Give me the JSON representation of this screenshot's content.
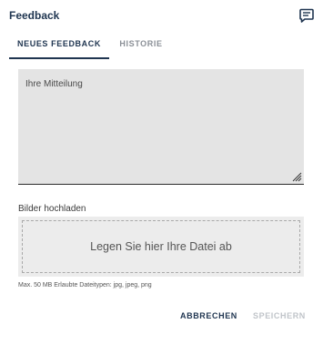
{
  "dialog": {
    "title": "Feedback",
    "header_icon": "feedback-icon"
  },
  "tabs": [
    {
      "label": "NEUES FEEDBACK",
      "active": true
    },
    {
      "label": "HISTORIE",
      "active": false
    }
  ],
  "message": {
    "placeholder": "Ihre Mitteilung",
    "value": ""
  },
  "upload": {
    "label": "Bilder hochladen",
    "dropzone_text": "Legen Sie hier Ihre Datei ab",
    "hint": "Max. 50 MB Erlaubte Dateitypen: jpg, jpeg, png"
  },
  "actions": {
    "cancel_label": "ABBRECHEN",
    "save_label": "SPEICHERN",
    "save_enabled": false
  },
  "colors": {
    "primary": "#1f3550",
    "inactive": "#8a8f96",
    "disabled": "#c0c4c9",
    "field_bg": "#e4e4e4",
    "dropzone_bg": "#ececec"
  }
}
